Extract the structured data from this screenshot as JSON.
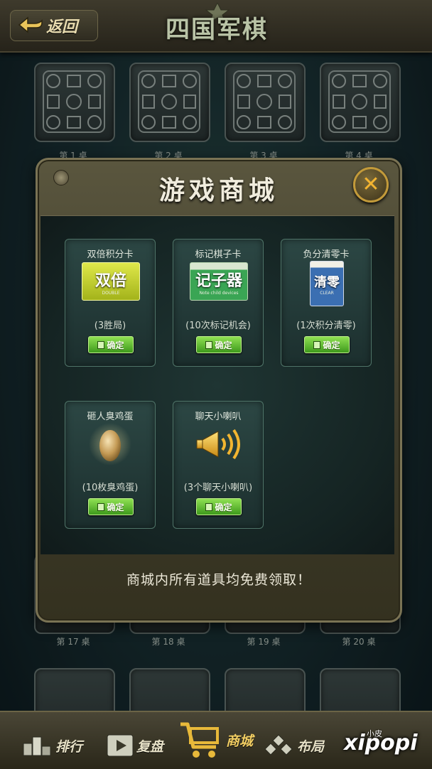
{
  "header": {
    "back_label": "返回",
    "game_title": "四国军棋"
  },
  "tables_top": [
    {
      "label": "第 1 桌"
    },
    {
      "label": "第 2 桌"
    },
    {
      "label": "第 3 桌"
    },
    {
      "label": "第 4 桌"
    }
  ],
  "tables_mid": [
    {
      "label": "第 17 桌"
    },
    {
      "label": "第 18 桌"
    },
    {
      "label": "第 19 桌"
    },
    {
      "label": "第 20 桌"
    }
  ],
  "shop": {
    "title": "游戏商城",
    "close_icon": "close-icon",
    "notice": "商城内所有道具均免费领取！",
    "items": [
      {
        "name": "双倍积分卡",
        "icon_text": "双倍",
        "icon_sub": "DOUBLE",
        "desc": "(3胜局)",
        "confirm_label": "确定",
        "icon": "double-card-icon"
      },
      {
        "name": "标记棋子卡",
        "icon_text": "记子器",
        "icon_sub": "Note child devices",
        "desc": "(10次标记机会)",
        "confirm_label": "确定",
        "icon": "marker-card-icon"
      },
      {
        "name": "负分清零卡",
        "icon_text": "清零",
        "icon_sub": "CLEAR",
        "desc": "(1次积分清零)",
        "confirm_label": "确定",
        "icon": "clear-card-icon"
      },
      {
        "name": "砸人臭鸡蛋",
        "desc": "(10枚臭鸡蛋)",
        "confirm_label": "确定",
        "icon": "egg-icon"
      },
      {
        "name": "聊天小喇叭",
        "desc": "(3个聊天小喇叭)",
        "confirm_label": "确定",
        "icon": "speaker-icon"
      }
    ]
  },
  "nav": {
    "rank_label": "排行",
    "replay_label": "复盘",
    "shop_label": "商城",
    "layout_label": "布局"
  },
  "watermark": {
    "small": "小皮",
    "main": "xipopi"
  },
  "colors": {
    "confirm_green": "#5cbf2a",
    "close_gold": "#f3b431",
    "double_card": "#c9d62a",
    "marker_card": "#2e9a4a",
    "clear_card": "#3b6fb2"
  }
}
